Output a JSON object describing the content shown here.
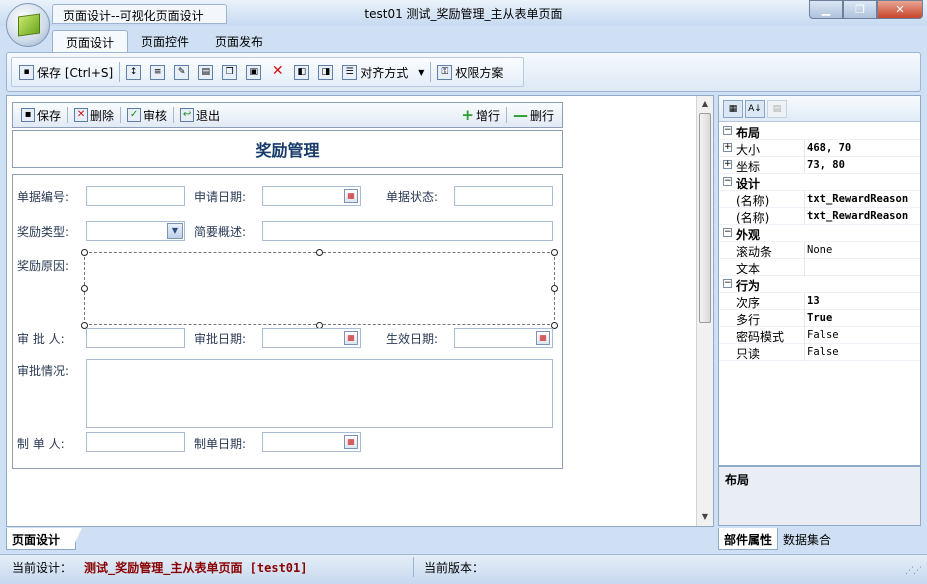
{
  "window": {
    "title": "test01  测试_奖励管理_主从表单页面",
    "quick_tab": "页面设计--可视化页面设计",
    "btn_min": "▁",
    "btn_max": "❐",
    "btn_close": "✕"
  },
  "menu": {
    "tabs": [
      {
        "label": "页面设计",
        "active": true
      },
      {
        "label": "页面控件"
      },
      {
        "label": "页面发布"
      }
    ]
  },
  "toolbar": {
    "save": "保存 [Ctrl+S]",
    "align": "对齐方式",
    "permission": "权限方案"
  },
  "form_toolbar": {
    "save": "保存",
    "delete": "删除",
    "audit": "审核",
    "exit": "退出",
    "add_row": "增行",
    "del_row": "删行"
  },
  "form": {
    "title": "奖励管理",
    "labels": {
      "doc_no": "单据编号:",
      "apply_date": "申请日期:",
      "doc_status": "单据状态:",
      "reward_type": "奖励类型:",
      "summary": "简要概述:",
      "reward_reason": "奖励原因:",
      "approver": "审 批 人:",
      "approve_date": "审批日期:",
      "effective_date": "生效日期:",
      "approve_info": "审批情况:",
      "creator": "制 单 人:",
      "create_date": "制单日期:"
    }
  },
  "properties": {
    "rows": [
      {
        "type": "cat",
        "name": "布局"
      },
      {
        "type": "prop",
        "expander": true,
        "name": "大小",
        "value": "468, 70",
        "bold": true
      },
      {
        "type": "prop",
        "expander": true,
        "name": "坐标",
        "value": "73, 80",
        "bold": true
      },
      {
        "type": "cat",
        "name": "设计"
      },
      {
        "type": "prop",
        "name": "(名称)",
        "value": "txt_RewardReason",
        "bold": true
      },
      {
        "type": "prop",
        "name": "(名称)",
        "value": "txt_RewardReason",
        "bold": true
      },
      {
        "type": "cat",
        "name": "外观"
      },
      {
        "type": "prop",
        "name": "滚动条",
        "value": "None"
      },
      {
        "type": "prop",
        "name": "文本",
        "value": ""
      },
      {
        "type": "cat",
        "name": "行为"
      },
      {
        "type": "prop",
        "name": "次序",
        "value": "13",
        "bold": true
      },
      {
        "type": "prop",
        "name": "多行",
        "value": "True",
        "bold": true
      },
      {
        "type": "prop",
        "name": "密码模式",
        "value": "False"
      },
      {
        "type": "prop",
        "name": "只读",
        "value": "False"
      }
    ],
    "description_title": "布局",
    "tabs": [
      {
        "label": "部件属性",
        "active": true
      },
      {
        "label": "数据集合"
      }
    ]
  },
  "bottom_tab": "页面设计",
  "status": {
    "design_label": "当前设计：",
    "design_value": "测试_奖励管理_主从表单页面 [test01]",
    "version_label": "当前版本："
  }
}
